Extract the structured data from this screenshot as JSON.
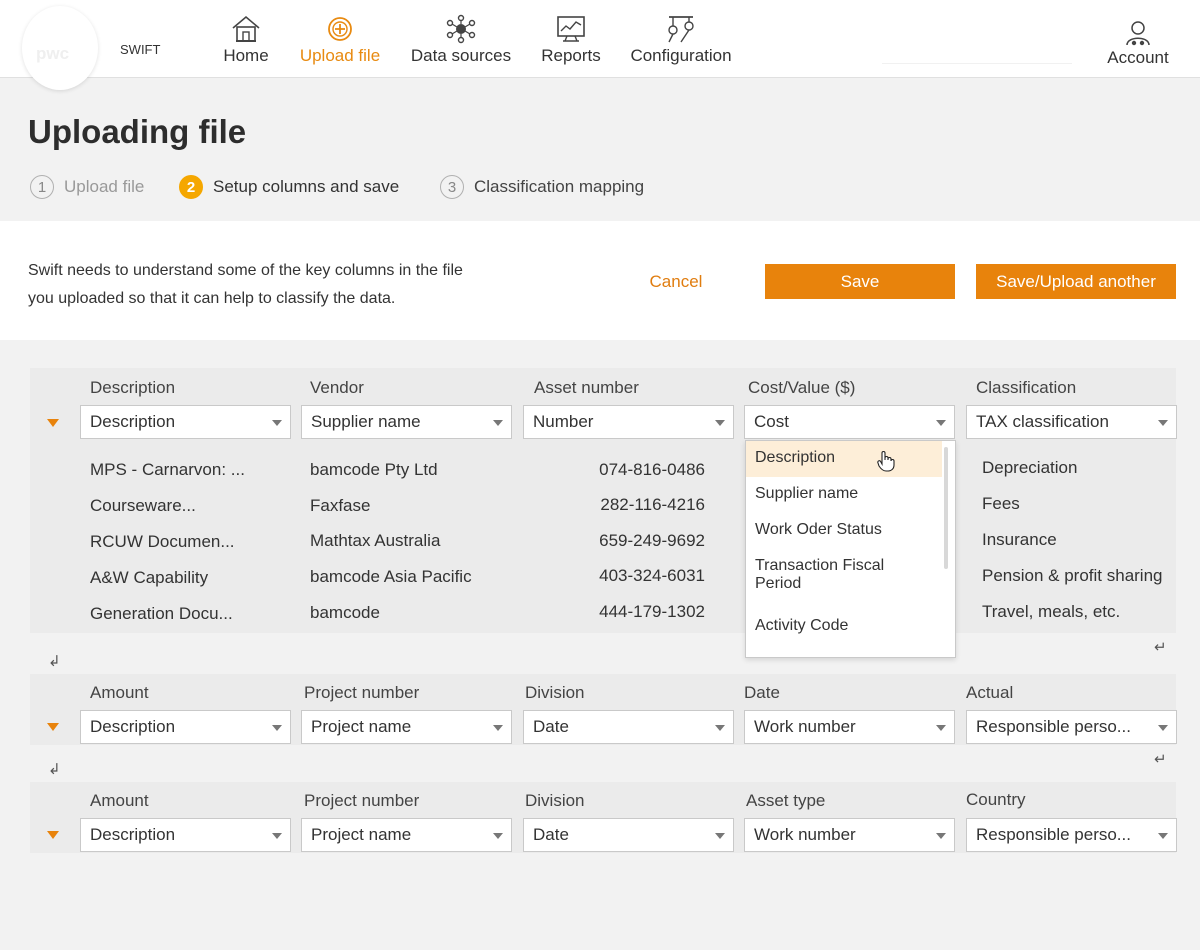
{
  "header": {
    "logo_text": "pwc",
    "app_name": "SWIFT",
    "nav": [
      {
        "label": "Home",
        "icon": "home-icon",
        "active": false
      },
      {
        "label": "Upload file",
        "icon": "upload-icon",
        "active": true
      },
      {
        "label": "Data sources",
        "icon": "data-sources-icon",
        "active": false
      },
      {
        "label": "Reports",
        "icon": "reports-icon",
        "active": false
      },
      {
        "label": "Configuration",
        "icon": "configuration-icon",
        "active": false
      }
    ],
    "account_label": "Account"
  },
  "page": {
    "title": "Uploading file",
    "steps": [
      {
        "num": "1",
        "label": "Upload file",
        "state": "done"
      },
      {
        "num": "2",
        "label": "Setup columns and save",
        "state": "current"
      },
      {
        "num": "3",
        "label": "Classification mapping",
        "state": "next"
      }
    ]
  },
  "panel": {
    "intro_line1": "Swift needs to understand some of the key columns in the file",
    "intro_line2": "you uploaded so that it can help to classify the data.",
    "cancel_label": "Cancel",
    "save_label": "Save",
    "save_upload_label": "Save/Upload another"
  },
  "group1": {
    "headers": [
      "Description",
      "Vendor",
      "Asset number",
      "Cost/Value ($)",
      "Classification"
    ],
    "selects": [
      "Description",
      "Supplier name",
      "Number",
      "Cost",
      "TAX classification"
    ],
    "rows": [
      {
        "description": "MPS - Carnarvon: ...",
        "vendor": "bamcode Pty Ltd",
        "asset": "074-816-0486",
        "classification": "Depreciation"
      },
      {
        "description": "Courseware...",
        "vendor": "Faxfase",
        "asset": "282-116-4216",
        "classification": "Fees"
      },
      {
        "description": "RCUW Documen...",
        "vendor": "Mathtax Australia",
        "asset": "659-249-9692",
        "classification": "Insurance"
      },
      {
        "description": "A&W Capability",
        "vendor": "bamcode Asia Pacific",
        "asset": "403-324-6031",
        "classification": "Pension & profit sharing"
      },
      {
        "description": "Generation Docu...",
        "vendor": "bamcode",
        "asset": "444-179-1302",
        "classification": "Travel, meals, etc."
      }
    ]
  },
  "dropdown": {
    "options": [
      "Description",
      "Supplier name",
      "Work Oder Status",
      "Transaction Fiscal Period",
      "Activity Code"
    ],
    "highlighted": "Description"
  },
  "group2": {
    "headers": [
      "Amount",
      "Project number",
      "Division",
      "Date",
      "Actual"
    ],
    "selects": [
      "Description",
      "Project name",
      "Date",
      "Work number",
      "Responsible perso..."
    ]
  },
  "group3": {
    "headers": [
      "Amount",
      "Project number",
      "Division",
      "Asset type",
      "Country"
    ],
    "selects": [
      "Description",
      "Project name",
      "Date",
      "Work number",
      "Responsible perso..."
    ]
  },
  "colors": {
    "accent": "#e8830c",
    "step_active": "#f5a700",
    "highlight": "#fdeed8"
  }
}
